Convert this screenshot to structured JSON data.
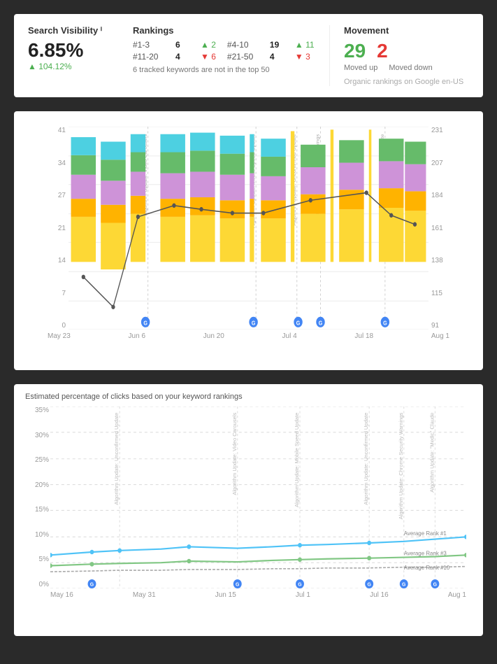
{
  "summary": {
    "sv_title": "Search Visibility ⁱ",
    "sv_value": "6.85%",
    "sv_change": "▲ 104.12%",
    "rankings_title": "Rankings",
    "row1": [
      {
        "range": "#1-3",
        "count": "6",
        "change_dir": "up",
        "change": "▲ 2"
      },
      {
        "range": "#4-10",
        "count": "19",
        "change_dir": "up",
        "change": "▲ 11"
      }
    ],
    "row2": [
      {
        "range": "#11-20",
        "count": "4",
        "change_dir": "down",
        "change": "▼ 6"
      },
      {
        "range": "#21-50",
        "count": "4",
        "change_dir": "down",
        "change": "▼ 3"
      }
    ],
    "tracked_info": "6 tracked keywords are not in the top 50",
    "movement_title": "Movement",
    "moved_up": "29",
    "moved_down": "2",
    "moved_up_label": "Moved up",
    "moved_down_label": "Moved down",
    "organic_info": "Organic rankings on Google en-US"
  },
  "bar_chart": {
    "y_left": [
      "41",
      "34",
      "27",
      "21",
      "14",
      "7",
      "0"
    ],
    "y_right": [
      "231",
      "207",
      "184",
      "161",
      "138",
      "115",
      "91"
    ],
    "x_labels": [
      "May 23",
      "Jun 6",
      "Jun 20",
      "Jul 4",
      "Jul 18",
      "Aug 1"
    ],
    "algorithm_updates": [
      {
        "label": "Algorithm Update: Video Carousels",
        "pct": 22
      },
      {
        "label": "Algorithm Update: Mobile Speed Update",
        "pct": 52
      },
      {
        "label": "Algorithm Update: Unconfirmed Update",
        "pct": 63
      },
      {
        "label": "Update: Unifying Chrome Security Warnings",
        "pct": 70
      },
      {
        "label": "Core Update",
        "pct": 88
      }
    ],
    "bars": [
      {
        "cyan": 8,
        "green": 10,
        "purple": 9,
        "orange": 6,
        "yellow": 7,
        "line": 14
      },
      {
        "cyan": 8,
        "green": 9,
        "purple": 9,
        "orange": 7,
        "yellow": 6,
        "line": 5
      },
      {
        "cyan": 8,
        "green": 10,
        "purple": 10,
        "orange": 7,
        "yellow": 7,
        "line": 23
      },
      {
        "cyan": 8,
        "green": 11,
        "purple": 10,
        "orange": 7,
        "yellow": 7,
        "line": 27
      },
      {
        "cyan": 8,
        "green": 10,
        "purple": 9,
        "orange": 7,
        "yellow": 6,
        "line": 22
      },
      {
        "cyan": 8,
        "green": 9,
        "purple": 9,
        "orange": 8,
        "yellow": 7,
        "line": 17
      },
      {
        "cyan": 8,
        "green": 10,
        "purple": 9,
        "orange": 7,
        "yellow": 7,
        "line": 16
      },
      {
        "cyan": 8,
        "green": 9,
        "purple": 8,
        "orange": 7,
        "yellow": 6,
        "line": 15
      },
      {
        "cyan": 7,
        "green": 8,
        "purple": 8,
        "orange": 7,
        "yellow": 7,
        "line": 15
      },
      {
        "cyan": 0,
        "green": 11,
        "purple": 10,
        "orange": 8,
        "yellow": 8,
        "line": 24
      },
      {
        "cyan": 0,
        "green": 11,
        "purple": 10,
        "orange": 9,
        "yellow": 9,
        "line": 28
      },
      {
        "cyan": 0,
        "green": 10,
        "purple": 9,
        "orange": 8,
        "yellow": 8,
        "line": 20
      }
    ]
  },
  "click_chart": {
    "title": "Estimated percentage of clicks based on your keyword rankings",
    "y_labels": [
      "35%",
      "30%",
      "25%",
      "20%",
      "15%",
      "10%",
      "5%",
      "0%"
    ],
    "x_labels": [
      "May 16",
      "May 31",
      "Jun 15",
      "Jul 1",
      "Jul 16",
      "Aug 1"
    ],
    "rank_labels": [
      "Average Rank #1",
      "Average Rank #3",
      "Average Rank #10"
    ],
    "lines": {
      "rank1_color": "#4fc3f7",
      "rank3_color": "#81c784",
      "rank10_color": "#aaa"
    }
  }
}
